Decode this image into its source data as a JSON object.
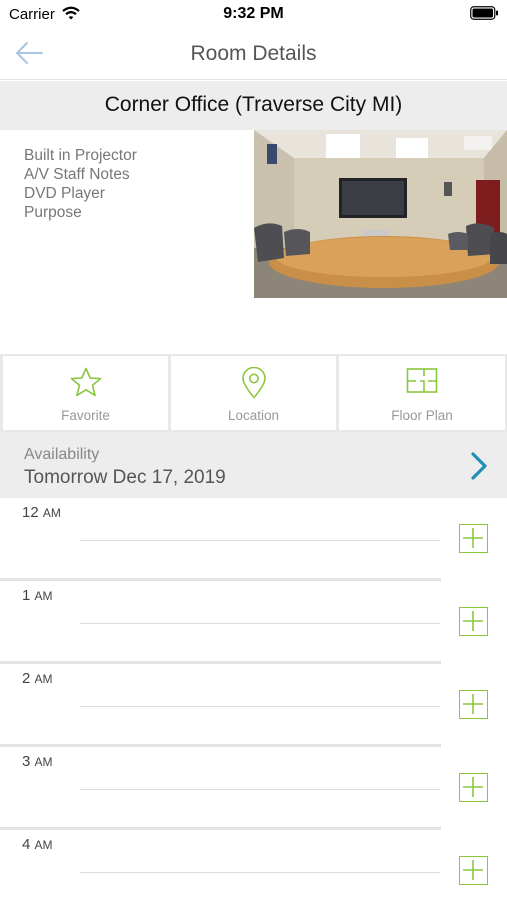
{
  "status_bar": {
    "carrier": "Carrier",
    "time": "9:32 PM"
  },
  "nav": {
    "title": "Room Details",
    "back_icon": "arrow-left-icon"
  },
  "room": {
    "title": "Corner Office (Traverse City MI)",
    "features": [
      "Built in Projector",
      "A/V Staff Notes",
      "DVD Player",
      "Purpose"
    ]
  },
  "actions": [
    {
      "label": "Favorite",
      "icon": "star-icon"
    },
    {
      "label": "Location",
      "icon": "map-pin-icon"
    },
    {
      "label": "Floor Plan",
      "icon": "floor-plan-icon"
    }
  ],
  "availability": {
    "label": "Availability",
    "date": "Tomorrow Dec 17, 2019"
  },
  "schedule": {
    "hours": [
      {
        "hour": "12",
        "ampm": "AM"
      },
      {
        "hour": "1",
        "ampm": "AM"
      },
      {
        "hour": "2",
        "ampm": "AM"
      },
      {
        "hour": "3",
        "ampm": "AM"
      },
      {
        "hour": "4",
        "ampm": "AM"
      }
    ]
  },
  "colors": {
    "accent_green": "#8cc63f",
    "chevron_blue": "#1f8fb8",
    "back_arrow": "#a9c4e6"
  }
}
